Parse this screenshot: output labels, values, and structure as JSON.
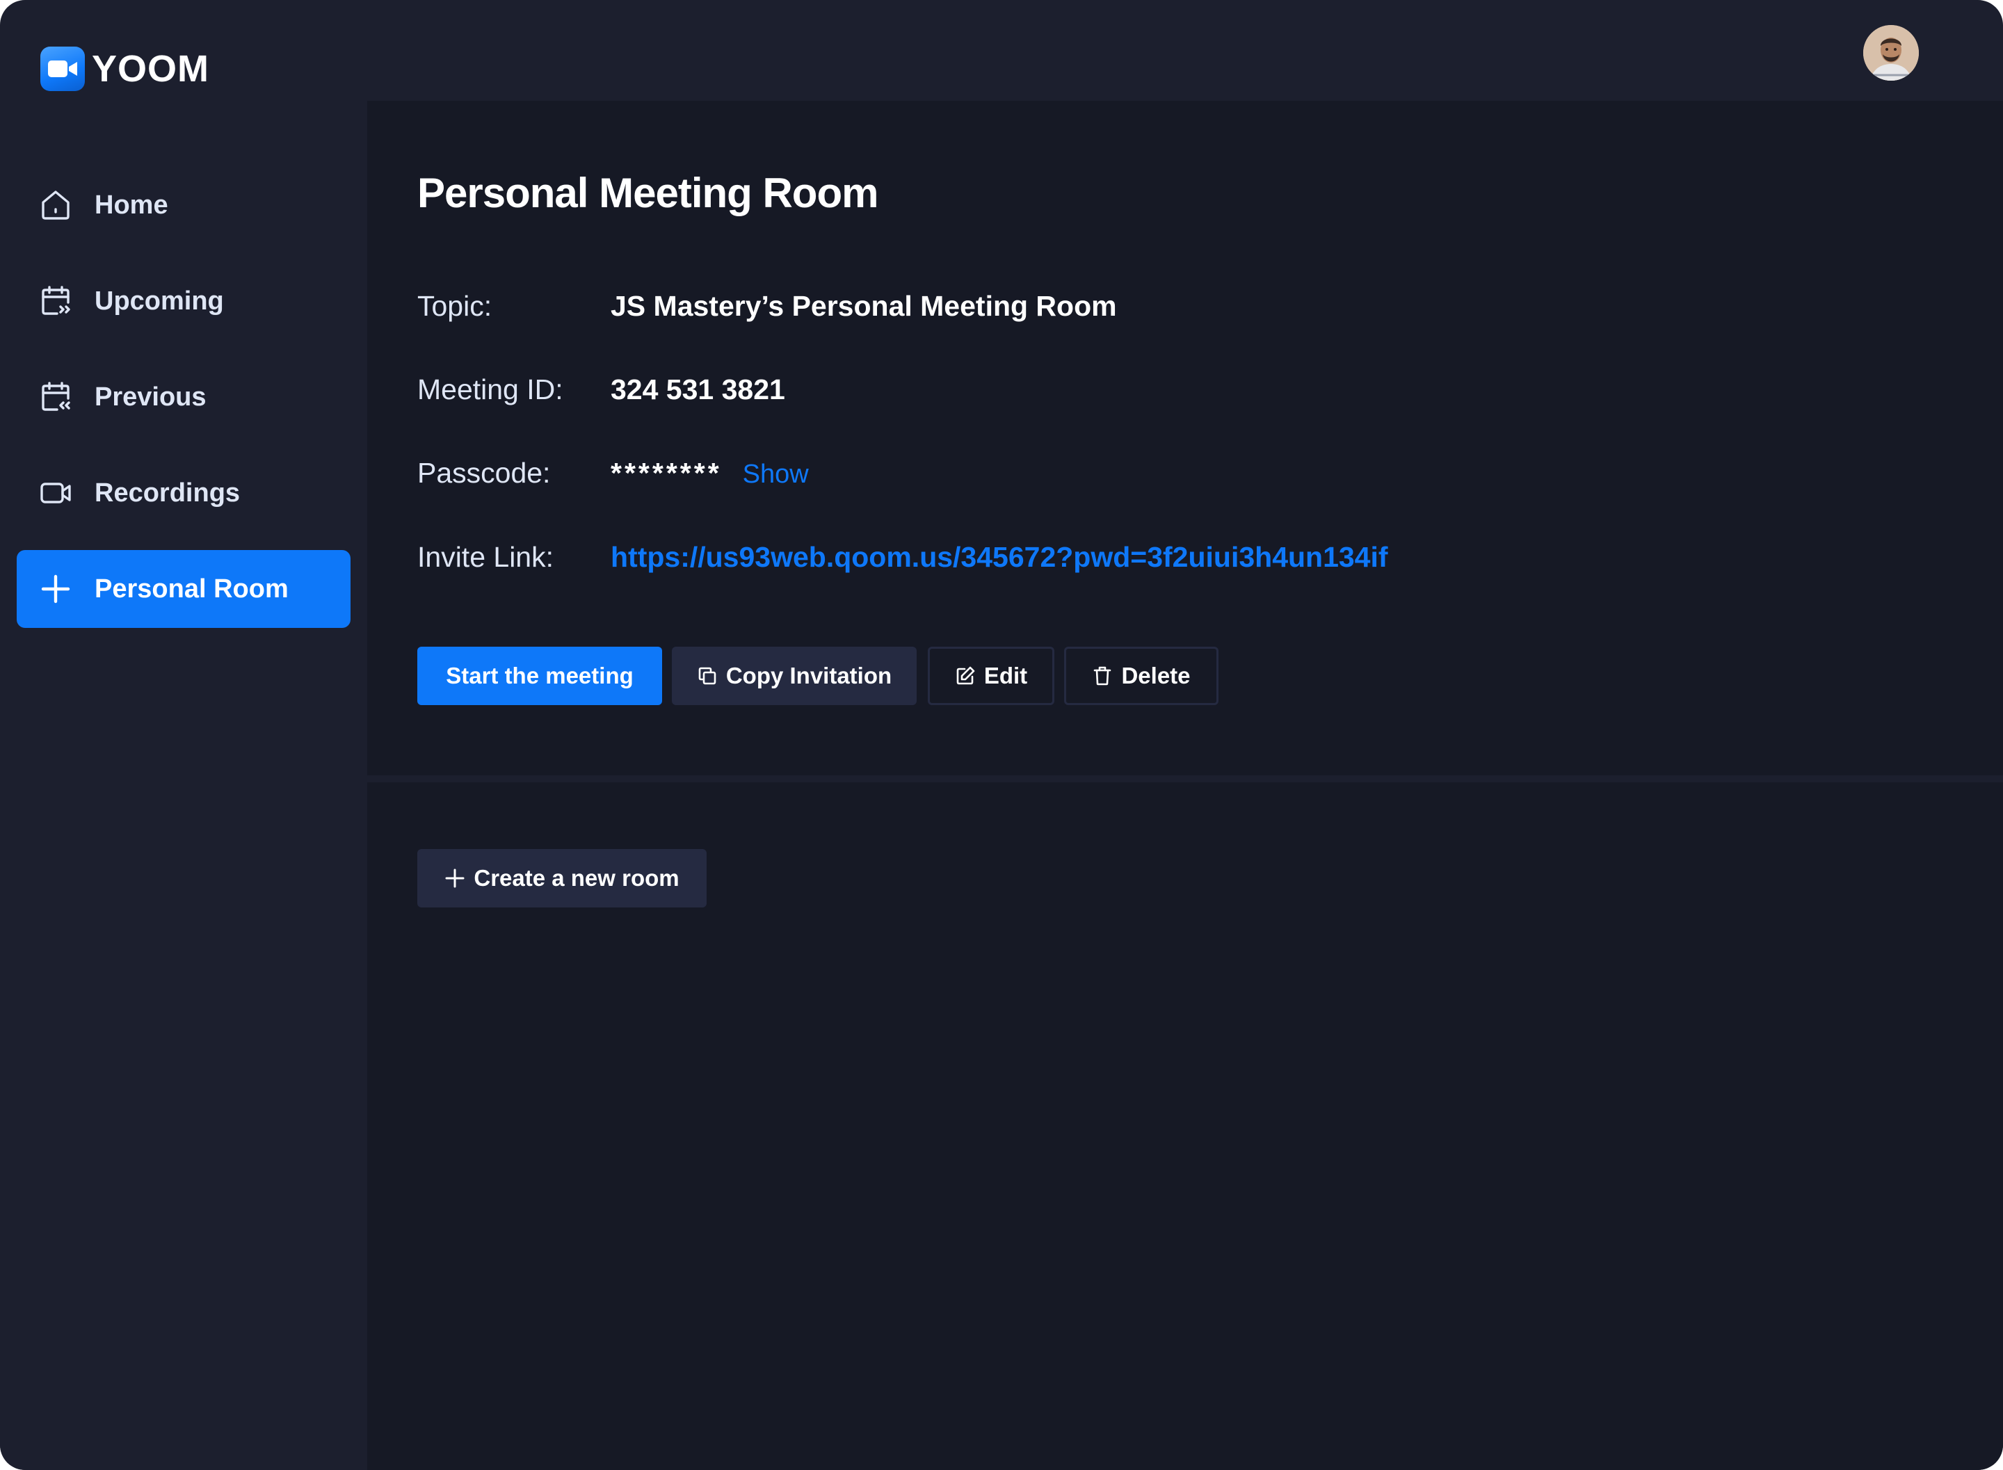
{
  "app": {
    "name": "YOOM",
    "logo_icon": "video-camera-icon",
    "accent": "#0e78f9",
    "background": "#1c1f2e",
    "panel": "#161925"
  },
  "sidebar": {
    "items": [
      {
        "label": "Home",
        "icon": "home-icon",
        "active": false
      },
      {
        "label": "Upcoming",
        "icon": "calendar-upcoming-icon",
        "active": false
      },
      {
        "label": "Previous",
        "icon": "calendar-previous-icon",
        "active": false
      },
      {
        "label": "Recordings",
        "icon": "video-icon",
        "active": false
      },
      {
        "label": "Personal Room",
        "icon": "plus-icon",
        "active": true
      }
    ]
  },
  "room": {
    "title": "Personal Meeting Room",
    "topic_label": "Topic:",
    "topic_value": "JS Mastery’s Personal Meeting Room",
    "meeting_id_label": "Meeting ID:",
    "meeting_id_value": "324 531 3821",
    "passcode_label": "Passcode:",
    "passcode_mask": "********",
    "passcode_show": "Show",
    "invite_label": "Invite Link:",
    "invite_link": "https://us93web.qoom.us/345672?pwd=3f2uiui3h4un134if"
  },
  "actions": {
    "start": "Start the meeting",
    "copy": "Copy Invitation",
    "edit": "Edit",
    "delete": "Delete",
    "create": "Create a new room"
  }
}
